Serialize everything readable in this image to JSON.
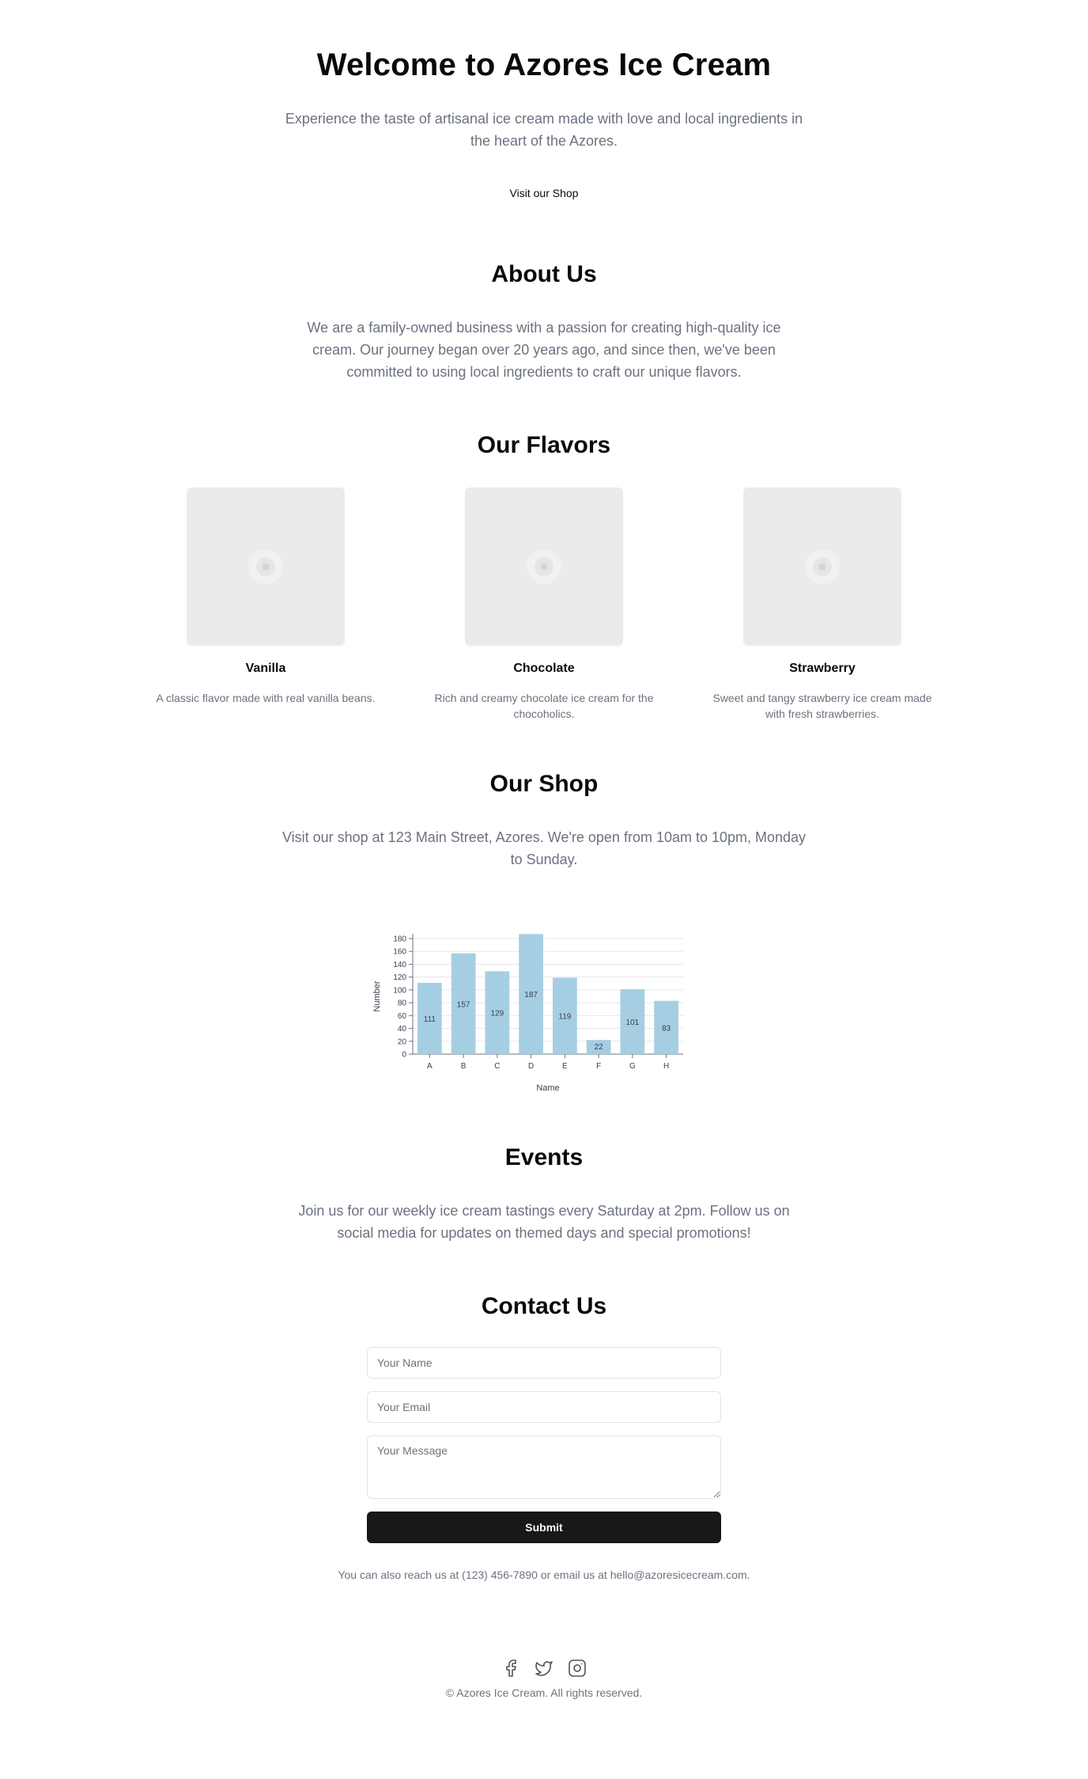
{
  "hero": {
    "title": "Welcome to Azores Ice Cream",
    "subtitle_line1": "Experience the taste of artisanal ice cream made with love and local ingredients in",
    "subtitle_line2": "the heart of the Azores.",
    "cta": "Visit our Shop"
  },
  "about": {
    "title": "About Us",
    "line1": "We are a family-owned business with a passion for creating high-quality ice",
    "line2": "cream. Our journey began over 20 years ago, and since then, we've been",
    "line3": "committed to using local ingredients to craft our unique flavors."
  },
  "flavors": {
    "title": "Our Flavors",
    "items": [
      {
        "name": "Vanilla",
        "desc_line1": "A classic flavor made with real vanilla beans.",
        "desc_line2": "",
        "image_icon": "image-placeholder-icon"
      },
      {
        "name": "Chocolate",
        "desc_line1": "Rich and creamy chocolate ice cream for the",
        "desc_line2": "chocoholics.",
        "image_icon": "image-placeholder-icon"
      },
      {
        "name": "Strawberry",
        "desc_line1": "Sweet and tangy strawberry ice cream made",
        "desc_line2": "with fresh strawberries.",
        "image_icon": "image-placeholder-icon"
      }
    ]
  },
  "shop": {
    "title": "Our Shop",
    "line1": "Visit our shop at 123 Main Street, Azores. We're open from 10am to 10pm, Monday",
    "line2": "to Sunday."
  },
  "chart_data": {
    "type": "bar",
    "categories": [
      "A",
      "B",
      "C",
      "D",
      "E",
      "F",
      "G",
      "H"
    ],
    "values": [
      111,
      157,
      129,
      187,
      119,
      22,
      101,
      83
    ],
    "xlabel": "Name",
    "ylabel": "Number",
    "ylim": [
      0,
      180
    ],
    "yticks": [
      0,
      20,
      40,
      60,
      80,
      100,
      120,
      140,
      160,
      180
    ],
    "grid": true,
    "bar_color": "#a6cee3"
  },
  "events": {
    "title": "Events",
    "line1": "Join us for our weekly ice cream tastings every Saturday at 2pm. Follow us on",
    "line2": "social media for updates on themed days and special promotions!"
  },
  "contact": {
    "title": "Contact Us",
    "name_placeholder": "Your Name",
    "email_placeholder": "Your Email",
    "message_placeholder": "Your Message",
    "submit_label": "Submit",
    "reach_text": "You can also reach us at (123) 456-7890 or email us at hello@azoresicecream.com."
  },
  "footer": {
    "icons": [
      "facebook-icon",
      "twitter-icon",
      "instagram-icon"
    ],
    "copyright": "© Azores Ice Cream. All rights reserved."
  }
}
